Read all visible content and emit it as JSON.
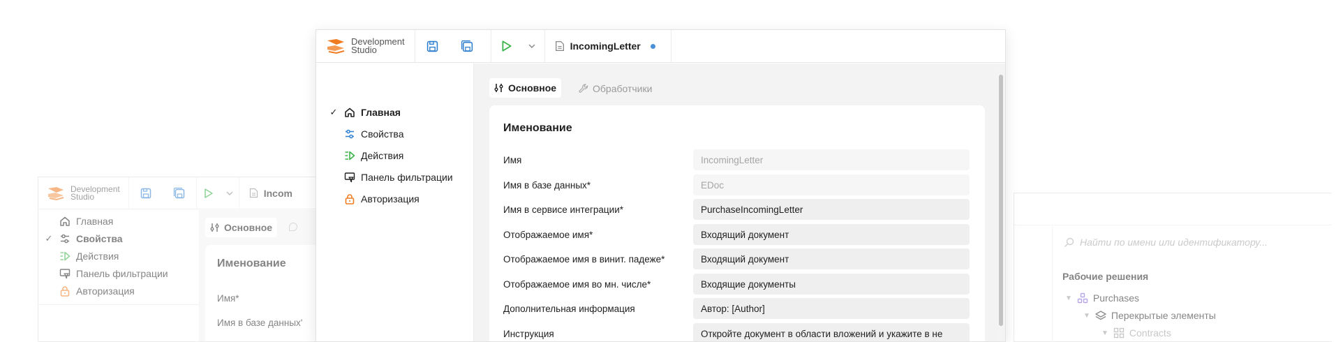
{
  "app": {
    "logo_line1": "Development",
    "logo_line2": "Studio",
    "tab_title": "IncomingLetter",
    "tab_title_truncated": "Incom",
    "brand_color": "#f07c22",
    "accent_blue": "#2f7fd0",
    "accent_green": "#3bb34a"
  },
  "front": {
    "nav": [
      {
        "label": "Главная",
        "icon": "home-icon",
        "selected": true
      },
      {
        "label": "Свойства",
        "icon": "sliders-icon",
        "selected": false
      },
      {
        "label": "Действия",
        "icon": "actions-icon",
        "selected": false
      },
      {
        "label": "Панель фильтрации",
        "icon": "filter-panel-icon",
        "selected": false
      },
      {
        "label": "Авторизация",
        "icon": "lock-icon",
        "selected": false
      }
    ],
    "tabs": [
      {
        "label": "Основное",
        "icon": "sliders-icon",
        "active": true
      },
      {
        "label": "Обработчики",
        "icon": "wrench-icon",
        "active": false
      }
    ],
    "section_title": "Именование",
    "fields": [
      {
        "label": "Имя",
        "value": "IncomingLetter",
        "readonly": true
      },
      {
        "label": "Имя в базе данных*",
        "value": "EDoc",
        "readonly": true
      },
      {
        "label": "Имя в сервисе интеграции*",
        "value": "PurchaseIncomingLetter",
        "readonly": false
      },
      {
        "label": "Отображаемое имя*",
        "value": "Входящий документ",
        "readonly": false
      },
      {
        "label": "Отображаемое имя в винит. падеже*",
        "value": "Входящий документ",
        "readonly": false
      },
      {
        "label": "Отображаемое имя во мн. числе*",
        "value": "Входящие документы",
        "readonly": false
      },
      {
        "label": "Дополнительная информация",
        "value": "Автор: [Author]",
        "readonly": false
      },
      {
        "label": "Инструкция",
        "value": "Откройте документ в области вложений и укажите в не",
        "readonly": false
      }
    ]
  },
  "back": {
    "nav": [
      {
        "label": "Главная",
        "icon": "home-icon",
        "selected": false
      },
      {
        "label": "Свойства",
        "icon": "sliders-icon",
        "selected": true
      },
      {
        "label": "Действия",
        "icon": "actions-icon",
        "selected": false
      },
      {
        "label": "Панель фильтрации",
        "icon": "filter-panel-icon",
        "selected": false
      },
      {
        "label": "Авторизация",
        "icon": "lock-icon",
        "selected": false
      }
    ],
    "tab_label": "Основное",
    "section_title": "Именование",
    "fields": [
      {
        "label": "Имя*"
      },
      {
        "label": "Имя в базе данных'"
      }
    ]
  },
  "right": {
    "search_placeholder": "Найти по имени или идентификатору...",
    "solutions_title": "Рабочие решения",
    "tree": [
      {
        "label": "Purchases",
        "icon": "solution-icon",
        "level": 0
      },
      {
        "label": "Перекрытые элементы",
        "icon": "layers-icon",
        "level": 1
      },
      {
        "label": "Contracts",
        "icon": "grid-icon",
        "level": 2
      }
    ]
  }
}
